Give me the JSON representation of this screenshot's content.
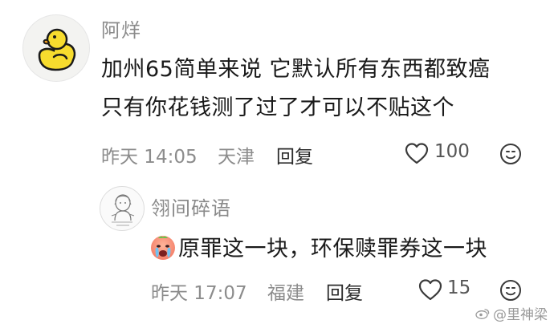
{
  "comment": {
    "username": "阿烊",
    "text_line1": "加州65简单来说 它默认所有东西都致癌",
    "text_line2": "只有你花钱测了过了才可以不贴这个",
    "time": "昨天 14:05",
    "location": "天津",
    "reply_label": "回复",
    "like_count": "100"
  },
  "reply": {
    "username": "翎间碎语",
    "text": "原罪这一块，环保赎罪券这一块",
    "time": "昨天 17:07",
    "location": "福建",
    "reply_label": "回复",
    "like_count": "15"
  },
  "watermark": {
    "text": "@里神梁"
  },
  "icons": {
    "avatar_main": "rubber-duck",
    "avatar_sub": "sketch-character",
    "like": "heart-outline-icon",
    "more": "smiley-icon",
    "emoji": "crying-face-emoji"
  }
}
